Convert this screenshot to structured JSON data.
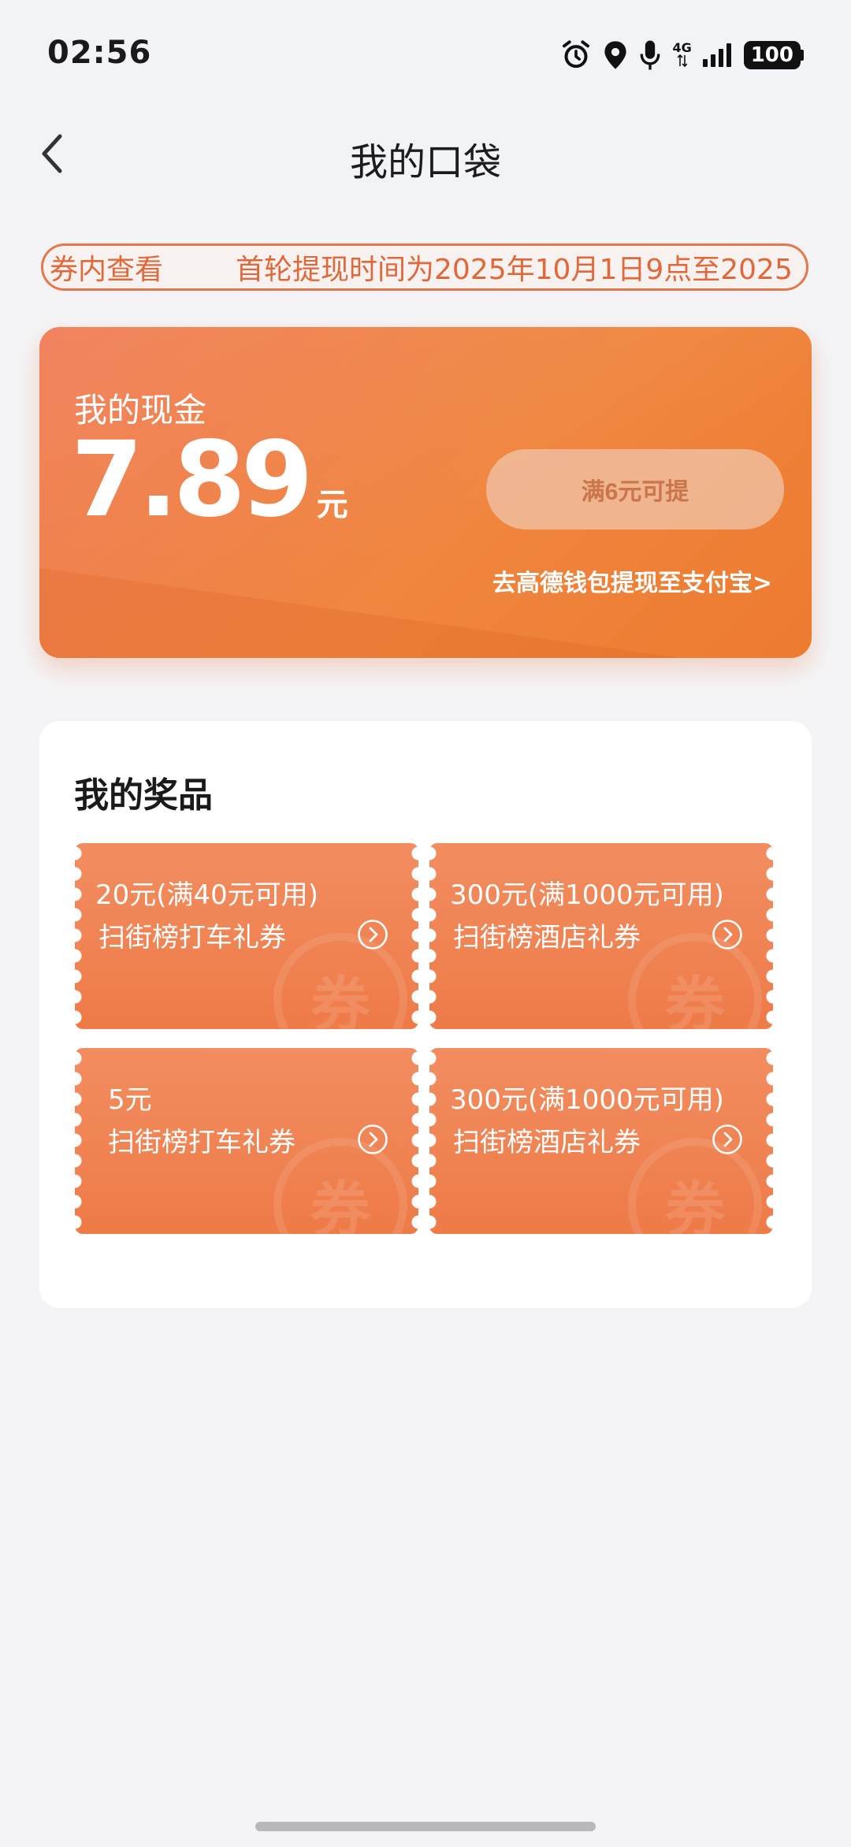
{
  "status_bar": {
    "time": "02:56",
    "network": "4G",
    "battery": "100"
  },
  "nav": {
    "title": "我的口袋"
  },
  "notice": {
    "left_text": "券内查看",
    "right_text": "首轮提现时间为2025年10月1日9点至2025"
  },
  "cash": {
    "label": "我的现金",
    "amount": "7.89",
    "unit": "元",
    "withdraw_button": "满6元可提",
    "wallet_link": "去高德钱包提现至支付宝>"
  },
  "prizes": {
    "title": "我的奖品",
    "coupons": [
      {
        "value": "20元(满40元可用)",
        "desc": "扫街榜打车礼券"
      },
      {
        "value": "300元(满1000元可用)",
        "desc": "扫街榜酒店礼券"
      },
      {
        "value": "5元",
        "desc": "扫街榜打车礼券"
      },
      {
        "value": "300元(满1000元可用)",
        "desc": "扫街榜酒店礼券"
      }
    ],
    "watermark": "券"
  },
  "colors": {
    "accent": "#ee7b48",
    "notice_border": "#e2784b",
    "background": "#f4f4f6"
  }
}
